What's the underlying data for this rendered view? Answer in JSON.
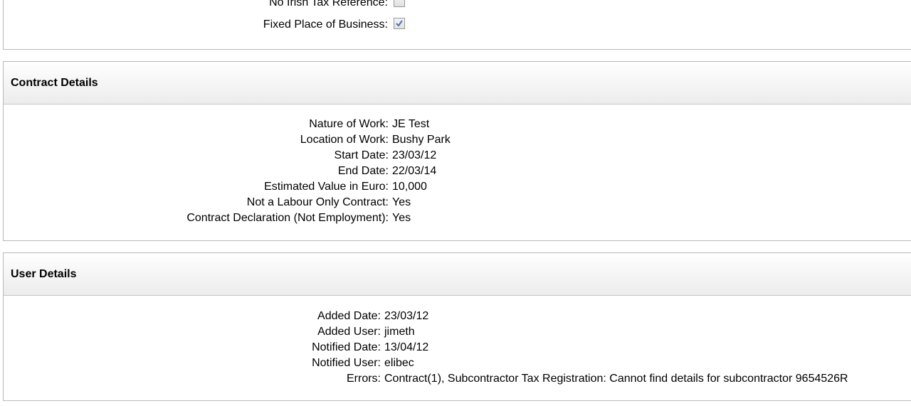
{
  "top_panel": {
    "rows": [
      {
        "label": "No Irish Tax Reference:",
        "checked": false
      },
      {
        "label": "Fixed Place of Business:",
        "checked": true
      }
    ]
  },
  "contract_details": {
    "title": "Contract Details",
    "rows": [
      {
        "label": "Nature of Work:",
        "value": "JE Test"
      },
      {
        "label": "Location of Work:",
        "value": "Bushy Park"
      },
      {
        "label": "Start Date:",
        "value": "23/03/12"
      },
      {
        "label": "End Date:",
        "value": "22/03/14"
      },
      {
        "label": "Estimated Value in Euro:",
        "value": "10,000"
      },
      {
        "label": "Not a Labour Only Contract:",
        "value": "Yes"
      },
      {
        "label": "Contract Declaration (Not Employment):",
        "value": "Yes"
      }
    ]
  },
  "user_details": {
    "title": "User Details",
    "rows": [
      {
        "label": "Added Date:",
        "value": "23/03/12"
      },
      {
        "label": "Added User:",
        "value": "jimeth"
      },
      {
        "label": "Notified Date:",
        "value": "13/04/12"
      },
      {
        "label": "Notified User:",
        "value": "elibec"
      },
      {
        "label": "Errors:",
        "value": "Contract(1), Subcontractor Tax Registration: Cannot find details for subcontractor 9654526R"
      }
    ]
  },
  "colors": {
    "check_mark": "#4a6fb5",
    "panel_border": "#b9b9b9"
  }
}
